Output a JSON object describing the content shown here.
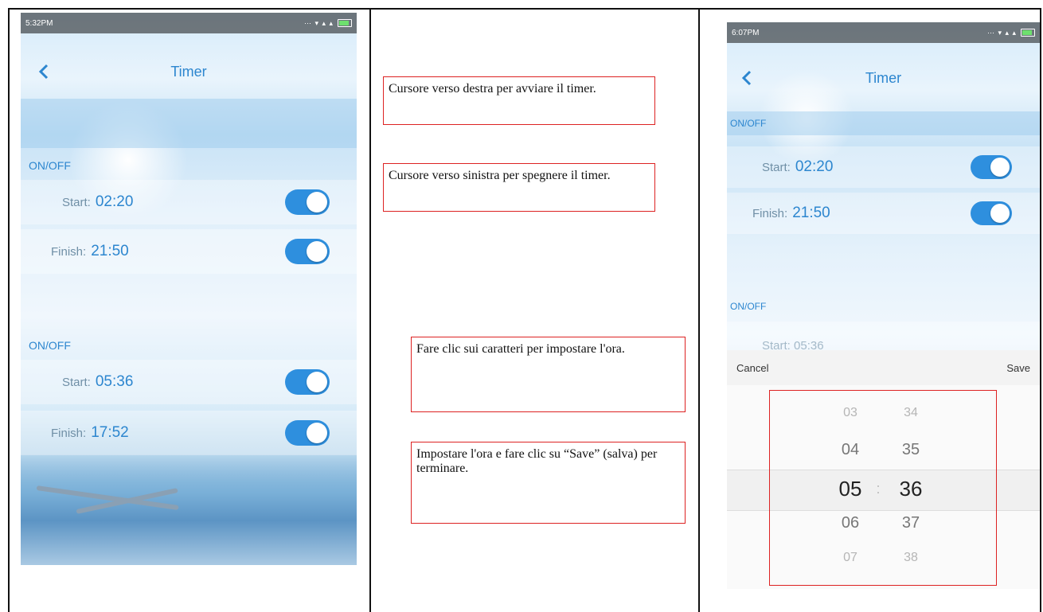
{
  "left_phone": {
    "status_time": "5:32PM",
    "title": "Timer",
    "sections": [
      {
        "label": "ON/OFF",
        "start_label": "Start:",
        "start_value": "02:20",
        "finish_label": "Finish:",
        "finish_value": "21:50"
      },
      {
        "label": "ON/OFF",
        "start_label": "Start:",
        "start_value": "05:36",
        "finish_label": "Finish:",
        "finish_value": "17:52"
      }
    ]
  },
  "callouts": {
    "start_timer": "Cursore verso destra per avviare il timer.",
    "stop_timer": "Cursore verso sinistra per spegnere il timer.",
    "set_time": "Fare clic sui caratteri per impostare l'ora.",
    "save_time": "Impostare l'ora e fare clic su “Save” (salva) per terminare."
  },
  "right_phone": {
    "status_time": "6:07PM",
    "title": "Timer",
    "section1_label": "ON/OFF",
    "start_label": "Start:",
    "start_value": "02:20",
    "finish_label": "Finish:",
    "finish_value": "21:50",
    "section2_label": "ON/OFF",
    "partial_row": "Start: 05:36",
    "cancel_label": "Cancel",
    "save_label": "Save",
    "hours": [
      "03",
      "04",
      "05",
      "06",
      "07"
    ],
    "minutes": [
      "34",
      "35",
      "36",
      "37",
      "38"
    ],
    "separator": ":"
  },
  "colors": {
    "accent": "#2c86cf",
    "toggle": "#2e8fde",
    "callout_border": "#dd2222"
  }
}
